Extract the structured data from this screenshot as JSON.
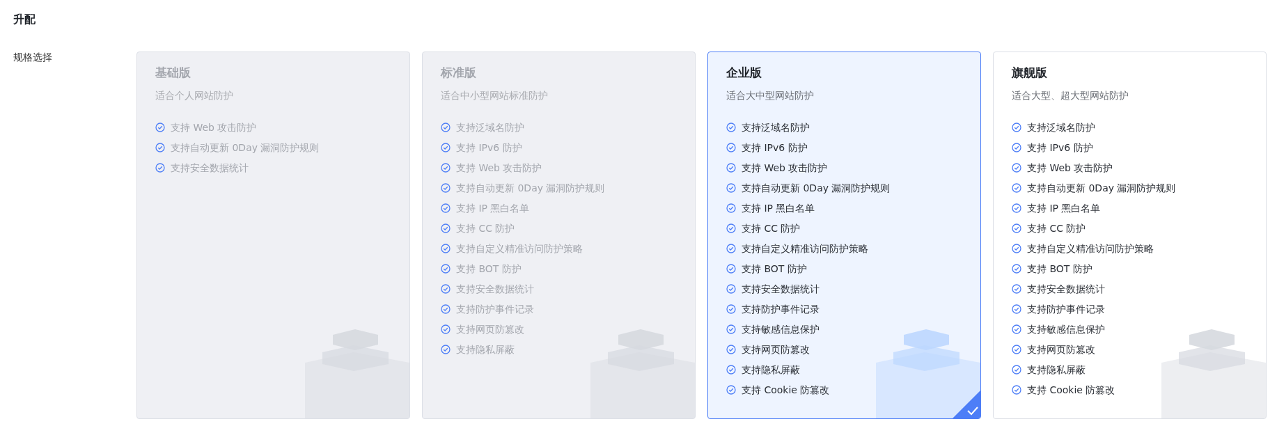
{
  "page_title": "升配",
  "field_label": "规格选择",
  "plans": [
    {
      "name": "基础版",
      "description": "适合个人网站防护",
      "disabled": true,
      "selected": false,
      "features": [
        "支持 Web 攻击防护",
        "支持自动更新 0Day 漏洞防护规则",
        "支持安全数据统计"
      ]
    },
    {
      "name": "标准版",
      "description": "适合中小型网站标准防护",
      "disabled": true,
      "selected": false,
      "features": [
        "支持泛域名防护",
        "支持 IPv6 防护",
        "支持 Web 攻击防护",
        "支持自动更新 0Day 漏洞防护规则",
        "支持 IP 黑白名单",
        "支持 CC 防护",
        "支持自定义精准访问防护策略",
        "支持 BOT 防护",
        "支持安全数据统计",
        "支持防护事件记录",
        "支持网页防篡改",
        "支持隐私屏蔽"
      ]
    },
    {
      "name": "企业版",
      "description": "适合大中型网站防护",
      "disabled": false,
      "selected": true,
      "features": [
        "支持泛域名防护",
        "支持 IPv6 防护",
        "支持 Web 攻击防护",
        "支持自动更新 0Day 漏洞防护规则",
        "支持 IP 黑白名单",
        "支持 CC 防护",
        "支持自定义精准访问防护策略",
        "支持 BOT 防护",
        "支持安全数据统计",
        "支持防护事件记录",
        "支持敏感信息保护",
        "支持网页防篡改",
        "支持隐私屏蔽",
        "支持 Cookie 防篡改"
      ]
    },
    {
      "name": "旗舰版",
      "description": "适合大型、超大型网站防护",
      "disabled": false,
      "selected": false,
      "features": [
        "支持泛域名防护",
        "支持 IPv6 防护",
        "支持 Web 攻击防护",
        "支持自动更新 0Day 漏洞防护规则",
        "支持 IP 黑白名单",
        "支持 CC 防护",
        "支持自定义精准访问防护策略",
        "支持 BOT 防护",
        "支持安全数据统计",
        "支持防护事件记录",
        "支持敏感信息保护",
        "支持网页防篡改",
        "支持隐私屏蔽",
        "支持 Cookie 防篡改"
      ]
    }
  ]
}
